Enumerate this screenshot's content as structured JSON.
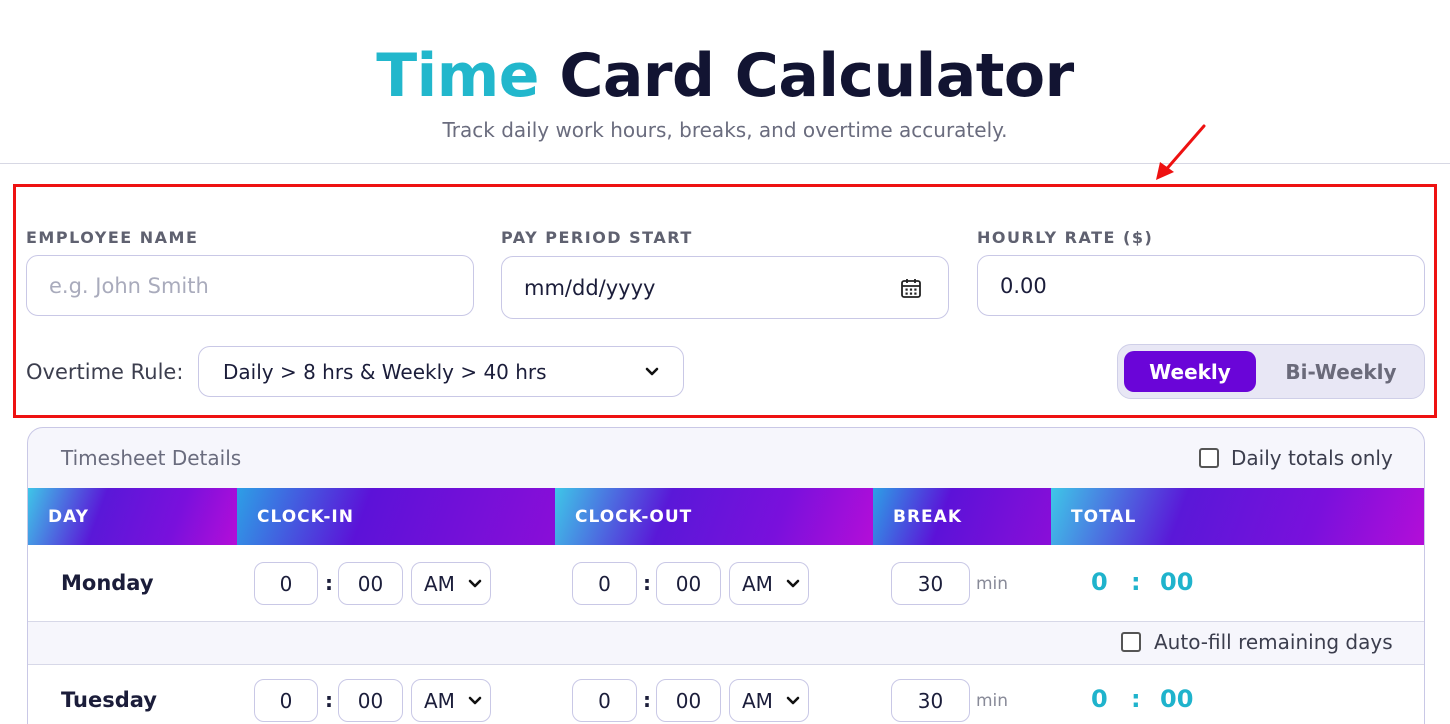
{
  "header": {
    "title_accent": "Time",
    "title_rest": "Card Calculator",
    "subtitle": "Track daily work hours, breaks, and overtime accurately."
  },
  "form": {
    "employee_name": {
      "label": "EMPLOYEE NAME",
      "placeholder": "e.g. John Smith",
      "value": ""
    },
    "pay_period_start": {
      "label": "PAY PERIOD START",
      "placeholder": "mm/dd/yyyy",
      "icon": "calendar-icon"
    },
    "hourly_rate": {
      "label": "HOURLY RATE ($)",
      "value": "0.00"
    },
    "overtime": {
      "label": "Overtime Rule:",
      "selected": "Daily > 8 hrs & Weekly > 40 hrs"
    },
    "period_toggle": {
      "options": [
        "Weekly",
        "Bi-Weekly"
      ],
      "active": "Weekly"
    }
  },
  "timesheet": {
    "title": "Timesheet Details",
    "daily_totals_label": "Daily totals only",
    "daily_totals_checked": false,
    "autofill_label": "Auto-fill remaining days",
    "autofill_checked": false,
    "columns": [
      "DAY",
      "CLOCK-IN",
      "CLOCK-OUT",
      "BREAK",
      "TOTAL"
    ],
    "break_unit": "min",
    "rows": [
      {
        "day": "Monday",
        "in_h": "0",
        "in_m": "00",
        "in_ampm": "AM",
        "out_h": "0",
        "out_m": "00",
        "out_ampm": "AM",
        "break": "30",
        "total_h": "0",
        "total_m": "00"
      },
      {
        "day": "Tuesday",
        "in_h": "0",
        "in_m": "00",
        "in_ampm": "AM",
        "out_h": "0",
        "out_m": "00",
        "out_ampm": "AM",
        "break": "30",
        "total_h": "0",
        "total_m": "00"
      }
    ]
  },
  "colors": {
    "accent_teal": "#22b7cc",
    "accent_purple": "#6a05d8",
    "highlight_red": "#ee1111"
  }
}
